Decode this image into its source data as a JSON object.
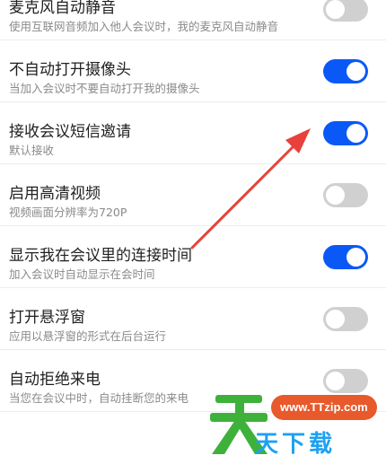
{
  "settings": {
    "items": [
      {
        "title": "麦克风自动静音",
        "subtitle": "使用互联网音频加入他人会议时，我的麦克风自动静音",
        "enabled": false
      },
      {
        "title": "不自动打开摄像头",
        "subtitle": "当加入会议时不要自动打开我的摄像头",
        "enabled": true
      },
      {
        "title": "接收会议短信邀请",
        "subtitle": "默认接收",
        "enabled": true
      },
      {
        "title": "启用高清视频",
        "subtitle": "视频画面分辨率为720P",
        "enabled": false
      },
      {
        "title": "显示我在会议里的连接时间",
        "subtitle": "加入会议时自动显示在会时间",
        "enabled": true
      },
      {
        "title": "打开悬浮窗",
        "subtitle": "应用以悬浮窗的形式在后台运行",
        "enabled": false
      },
      {
        "title": "自动拒绝来电",
        "subtitle": "当您在会议中时，自动挂断您的来电",
        "enabled": false
      }
    ]
  },
  "colors": {
    "toggle_on": "#0a59f7",
    "toggle_off": "#d0d0d0",
    "annotation_arrow": "#e8413c"
  },
  "watermark": {
    "url": "www.TTzip.com",
    "text": "天下载"
  }
}
